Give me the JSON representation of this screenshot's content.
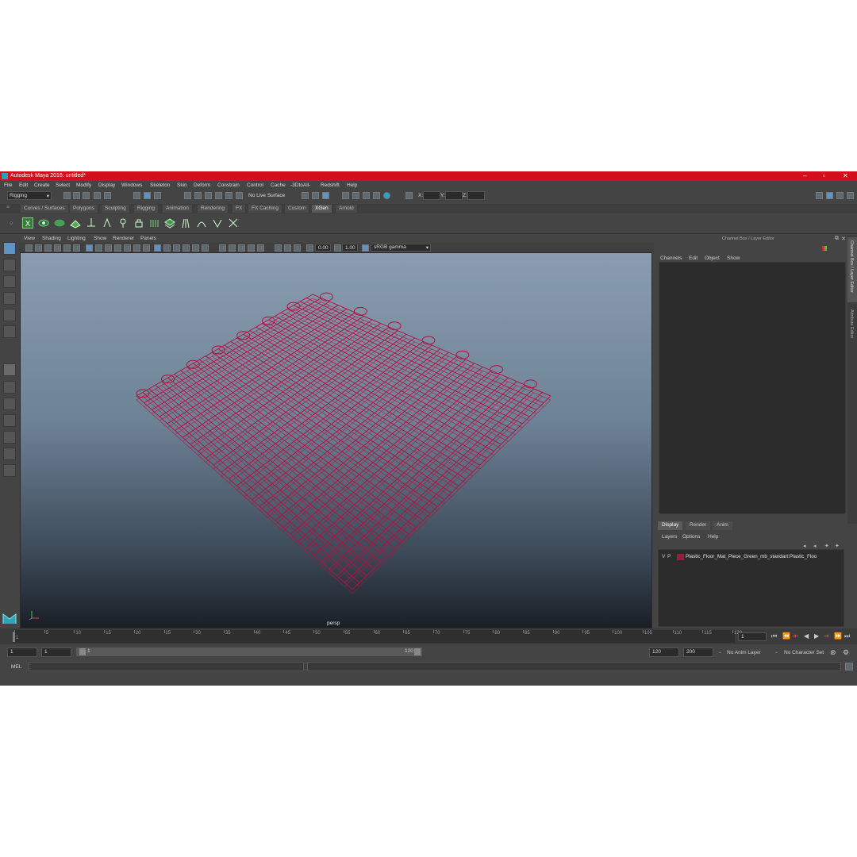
{
  "window": {
    "title": "Autodesk Maya 2016: untitled*"
  },
  "menu": [
    "File",
    "Edit",
    "Create",
    "Select",
    "Modify",
    "Display",
    "Windows",
    "Skeleton",
    "Skin",
    "Deform",
    "Constrain",
    "Control",
    "Cache",
    "-3DtoAll-",
    "Redshift",
    "Help"
  ],
  "status": {
    "mode": "Rigging",
    "live_surface": "No Live Surface",
    "xyz": [
      "X:",
      "Y:",
      "Z:"
    ]
  },
  "shelf": {
    "tabs": [
      "Curves / Surfaces",
      "Polygons",
      "Sculpting",
      "Rigging",
      "Animation",
      "Rendering",
      "FX",
      "FX Caching",
      "Custom",
      "XGen",
      "Arnold"
    ],
    "active_tab": "XGen"
  },
  "panel": {
    "menu": [
      "View",
      "Shading",
      "Lighting",
      "Show",
      "Renderer",
      "Panels"
    ],
    "exposure": "0.00",
    "gamma": "1.00",
    "color_space": "sRGB gamma",
    "camera_label": "persp"
  },
  "channel_box": {
    "title": "Channel Box / Layer Editor",
    "menu": [
      "Channels",
      "Edit",
      "Object",
      "Show"
    ]
  },
  "side_tabs": [
    "Channel Box / Layer Editor",
    "Attribute Editor"
  ],
  "layer_editor": {
    "tabs": [
      "Display",
      "Render",
      "Anim"
    ],
    "active_tab": "Display",
    "menu": [
      "Layers",
      "Options",
      "Help"
    ],
    "layers": [
      {
        "v": "V",
        "p": "P",
        "name": "Plastic_Floor_Mat_Piece_Green_mb_standart:Plastic_Floo",
        "color": "#9b1b3a"
      }
    ]
  },
  "timeline": {
    "ticks": [
      "1",
      "5",
      "10",
      "15",
      "20",
      "25",
      "30",
      "35",
      "40",
      "45",
      "50",
      "55",
      "60",
      "65",
      "70",
      "75",
      "80",
      "85",
      "90",
      "95",
      "100",
      "105",
      "110",
      "115",
      "120"
    ],
    "current_frame": "1"
  },
  "range": {
    "start": "1",
    "inner_start": "1",
    "slider_start": "1",
    "slider_end": "120",
    "end": "120",
    "outer_end": "200",
    "anim_layer": "No Anim Layer",
    "character_set": "No Character Set"
  },
  "command": {
    "label": "MEL"
  },
  "colors": {
    "title_bar": "#d40f1d",
    "wire": "#b3123f",
    "accent": "#5f93c4"
  }
}
